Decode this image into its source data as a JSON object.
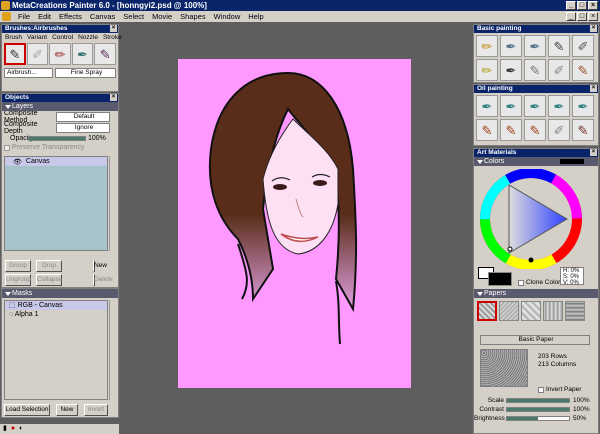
{
  "window": {
    "title": "MetaCreations Painter 6.0 - [honngyi2.psd @ 100%]"
  },
  "menu": [
    "File",
    "Edit",
    "Effects",
    "Canvas",
    "Select",
    "Movie",
    "Shapes",
    "Window",
    "Help"
  ],
  "brushes": {
    "title": "Brushes:Airbrushes",
    "menu": [
      "Brush",
      "Variant",
      "Control",
      "Nozzle",
      "Stroke"
    ],
    "category": "Airbrush...",
    "variant": "Fine Spray"
  },
  "objects": {
    "title": "Objects",
    "layers_label": "Layers",
    "composite_method_label": "Composite Method",
    "composite_method": "Default",
    "composite_depth_label": "Composite Depth",
    "composite_depth": "Ignore",
    "opacity_label": "Opacity",
    "opacity": 0.0,
    "opacity_text": "100%",
    "preserve_label": "Preserve Transparency",
    "canvas_item": "Canvas",
    "buttons": [
      "Group",
      "Drop",
      "New",
      "Ungroup",
      "Collapse",
      "Delete"
    ]
  },
  "masks": {
    "label": "Masks",
    "items": [
      "RGB - Canvas",
      "Alpha 1"
    ],
    "buttons": [
      "Load Selection",
      "New",
      "Invert"
    ]
  },
  "basic_painting": {
    "title": "Basic painting"
  },
  "oil_painting": {
    "title": "Oil painting"
  },
  "art_materials": {
    "title": "Art Materials",
    "colors_label": "Colors",
    "hsv": [
      {
        "k": "H:",
        "v": "0%"
      },
      {
        "k": "S:",
        "v": "0%"
      },
      {
        "k": "V:",
        "v": "0%"
      }
    ],
    "clone_color": "Clone Color"
  },
  "papers": {
    "label": "Papers",
    "name": "Basic Paper",
    "rows": "203 Rows",
    "cols": "213 Columns",
    "invert": "Invert Paper",
    "sliders": [
      {
        "label": "Scale",
        "value": "100%",
        "level": 1.0
      },
      {
        "label": "Contrast",
        "value": "100%",
        "level": 1.0
      },
      {
        "label": "Brightness",
        "value": "50%",
        "level": 0.5
      }
    ]
  },
  "colors": {
    "title_bar": "#0a246a",
    "canvas_bg": "#ff99ff",
    "hair": "#5a2d1a",
    "workspace": "#5e5e5e"
  }
}
